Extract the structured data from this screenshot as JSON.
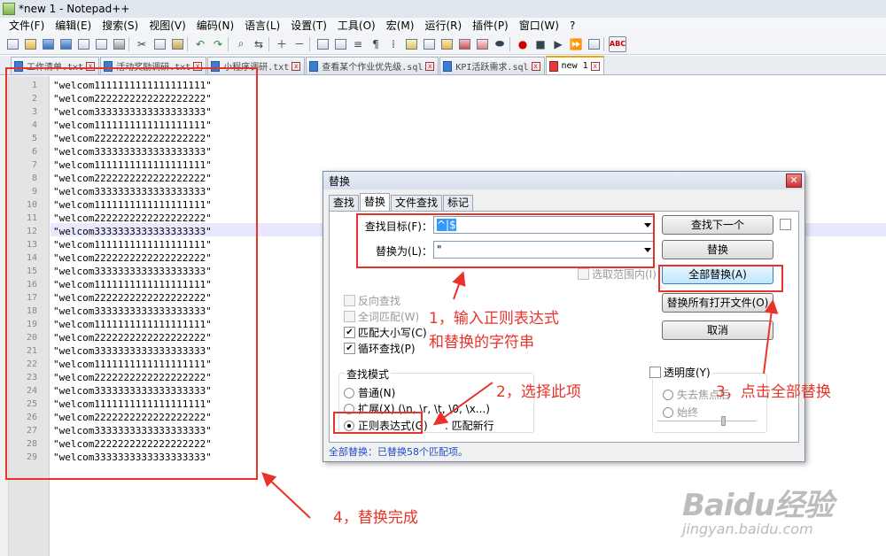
{
  "window": {
    "title": "*new 1 - Notepad++"
  },
  "menu": [
    "文件(F)",
    "编辑(E)",
    "搜索(S)",
    "视图(V)",
    "编码(N)",
    "语言(L)",
    "设置(T)",
    "工具(O)",
    "宏(M)",
    "运行(R)",
    "插件(P)",
    "窗口(W)",
    "?"
  ],
  "tabs": [
    {
      "label": "工作清单.txt"
    },
    {
      "label": "活动奖励调研.txt"
    },
    {
      "label": "小程序调研.txt"
    },
    {
      "label": "查看某个作业优先级.sql"
    },
    {
      "label": "KPI活跃需求.sql"
    },
    {
      "label": "new 1"
    }
  ],
  "editor": {
    "line_numbers": [
      "1",
      "2",
      "3",
      "4",
      "5",
      "6",
      "7",
      "8",
      "9",
      "10",
      "11",
      "12",
      "13",
      "14",
      "15",
      "16",
      "17",
      "18",
      "19",
      "20",
      "21",
      "22",
      "23",
      "24",
      "25",
      "26",
      "27",
      "28",
      "29"
    ],
    "lines": [
      "\"welcom1111111111111111111\"",
      "\"welcom2222222222222222222\"",
      "\"welcom3333333333333333333\"",
      "\"welcom1111111111111111111\"",
      "\"welcom2222222222222222222\"",
      "\"welcom3333333333333333333\"",
      "\"welcom1111111111111111111\"",
      "\"welcom2222222222222222222\"",
      "\"welcom3333333333333333333\"",
      "\"welcom1111111111111111111\"",
      "\"welcom2222222222222222222\"",
      "\"welcom3333333333333333333\"",
      "\"welcom1111111111111111111\"",
      "\"welcom2222222222222222222\"",
      "\"welcom3333333333333333333\"",
      "\"welcom1111111111111111111\"",
      "\"welcom2222222222222222222\"",
      "\"welcom3333333333333333333\"",
      "\"welcom1111111111111111111\"",
      "\"welcom2222222222222222222\"",
      "\"welcom3333333333333333333\"",
      "\"welcom1111111111111111111\"",
      "\"welcom2222222222222222222\"",
      "\"welcom3333333333333333333\"",
      "\"welcom1111111111111111111\"",
      "\"welcom2222222222222222222\"",
      "\"welcom3333333333333333333\"",
      "\"welcom2222222222222222222\"",
      "\"welcom3333333333333333333\""
    ]
  },
  "dialog": {
    "title": "替换",
    "tabs": [
      "查找",
      "替换",
      "文件查找",
      "标记"
    ],
    "find_label": "查找目标(F)：",
    "find_value": "^|$",
    "replace_label": "替换为(L)：",
    "replace_value": "\"",
    "in_selection": "选取范围内(I)",
    "buttons": {
      "find_next": "查找下一个",
      "replace": "替换",
      "replace_all": "全部替换(A)",
      "replace_all_open": "替换所有打开文件(O)",
      "cancel": "取消"
    },
    "options": {
      "reverse": "反向查找",
      "whole_word": "全词匹配(W)",
      "match_case": "匹配大小写(C)",
      "wrap": "循环查找(P)"
    },
    "search_mode": {
      "title": "查找模式",
      "normal": "普通(N)",
      "extended": "扩展(X) (\\n, \\r, \\t, \\0, \\x...)",
      "regex": "正则表达式(G)",
      "dot_newline": ". 匹配新行"
    },
    "transparency": {
      "title": "透明度(Y)",
      "on_lose_focus": "失去焦点后",
      "always": "始终"
    },
    "status": "全部替换：已替换58个匹配项。"
  },
  "annotations": {
    "step1_line1": "1，输入正则表达式",
    "step1_line2": "和替换的字符串",
    "step2": "2，选择此项",
    "step3": "3，点击全部替换",
    "step4": "4，替换完成"
  },
  "watermark": {
    "brand": "Baidu经验",
    "url": "jingyan.baidu.com"
  }
}
